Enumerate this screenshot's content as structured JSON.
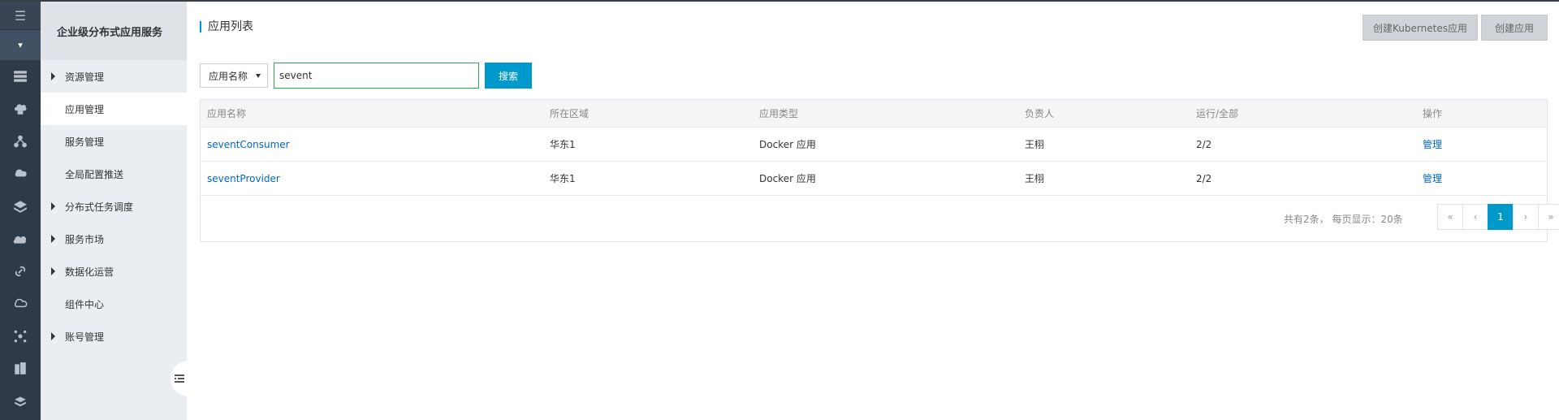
{
  "rail": {
    "menu_glyph": "☰",
    "dropdown_glyph": "▾",
    "icons": [
      "server-icon",
      "cloud-bag-icon",
      "cluster-icon",
      "cloud-upload-icon",
      "layers-icon",
      "cloud-gear-icon",
      "link-icon",
      "cloud-outline-icon",
      "network-icon",
      "building-icon",
      "stack-icon"
    ]
  },
  "menu": {
    "header": "企业级分布式应用服务",
    "items": [
      {
        "label": "资源管理",
        "caret": true,
        "active": false
      },
      {
        "label": "应用管理",
        "caret": false,
        "active": true
      },
      {
        "label": "服务管理",
        "caret": false,
        "active": false
      },
      {
        "label": "全局配置推送",
        "caret": false,
        "active": false
      },
      {
        "label": "分布式任务调度",
        "caret": true,
        "active": false
      },
      {
        "label": "服务市场",
        "caret": true,
        "active": false
      },
      {
        "label": "数据化运营",
        "caret": true,
        "active": false
      },
      {
        "label": "组件中心",
        "caret": false,
        "active": false
      },
      {
        "label": "账号管理",
        "caret": true,
        "active": false
      }
    ]
  },
  "page": {
    "title": "应用列表",
    "create_k8s_label": "创建Kubernetes应用",
    "create_app_label": "创建应用"
  },
  "filter": {
    "select_value": "应用名称",
    "search_value": "sevent",
    "search_button": "搜索"
  },
  "table": {
    "columns": [
      "应用名称",
      "所在区域",
      "应用类型",
      "负责人",
      "运行/全部",
      "操作"
    ],
    "rows": [
      {
        "name": "seventConsumer",
        "region": "华东1",
        "type": "Docker 应用",
        "owner": "王栩",
        "running": "2/2",
        "action": "管理"
      },
      {
        "name": "seventProvider",
        "region": "华东1",
        "type": "Docker 应用",
        "owner": "王栩",
        "running": "2/2",
        "action": "管理"
      }
    ]
  },
  "pagination": {
    "summary": "共有2条， 每页显示：20条",
    "first": "«",
    "prev": "‹",
    "current": "1",
    "next": "›",
    "last": "»"
  },
  "colors": {
    "accent": "#0099cc",
    "link": "#0066cc",
    "rail_bg": "#2f3a48",
    "menu_bg": "#eaedf1"
  }
}
